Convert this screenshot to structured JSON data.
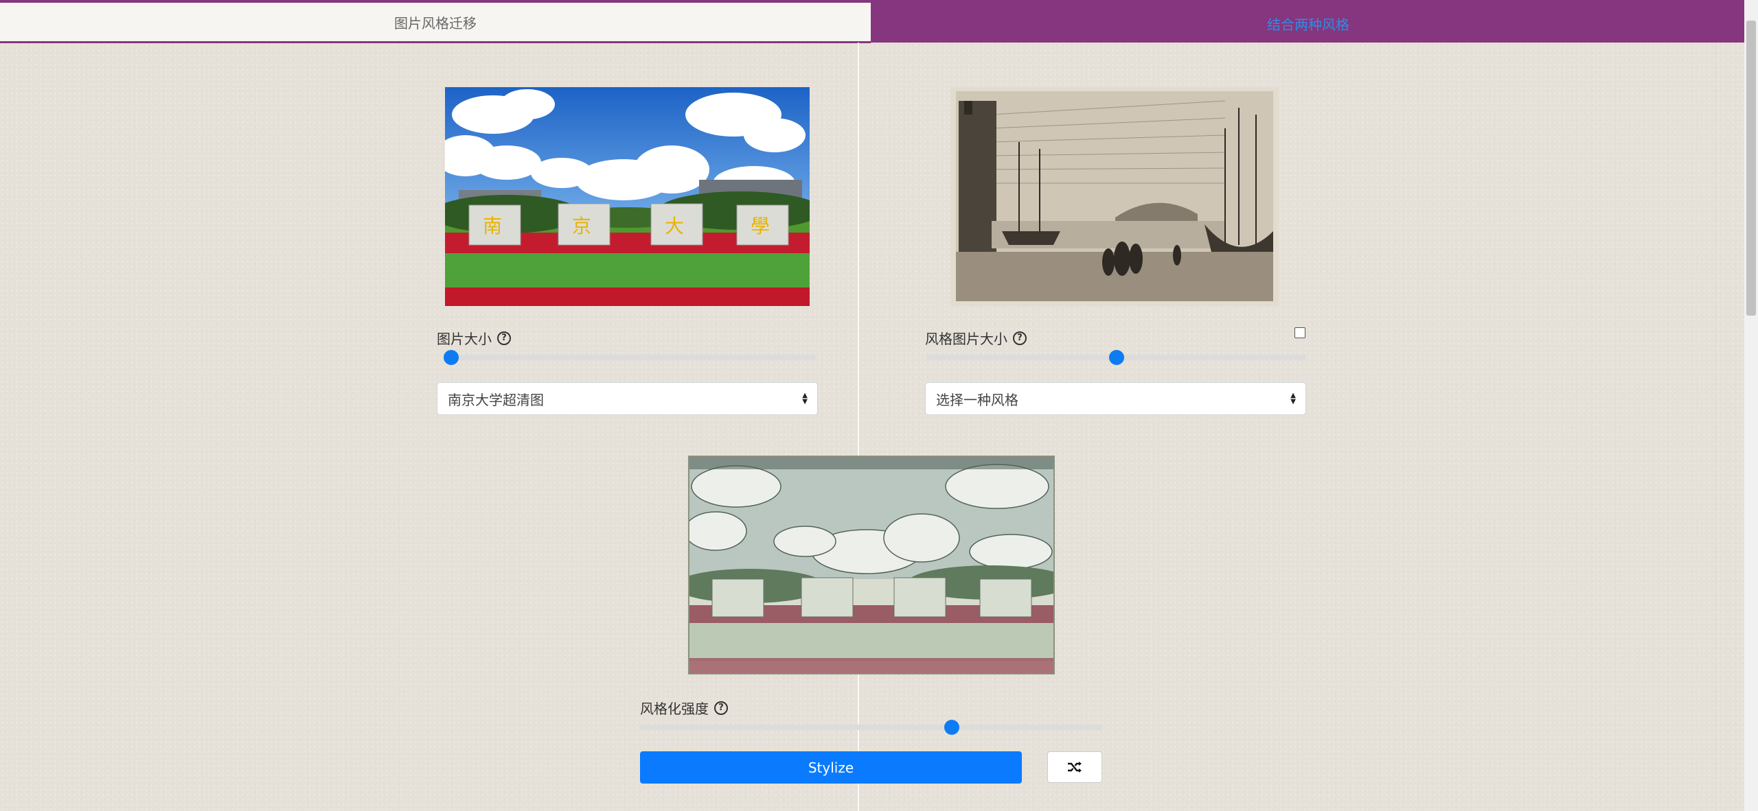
{
  "tabs": [
    {
      "label": "图片风格迁移",
      "active": true
    },
    {
      "label": "结合两种风格",
      "active": false
    }
  ],
  "content": {
    "size_label": "图片大小",
    "size_value": 0.0,
    "image_select": "南京大学超清图"
  },
  "style": {
    "size_label": "风格图片大小",
    "size_value": 0.5,
    "image_select": "选择一种风格"
  },
  "result": {
    "strength_label": "风格化强度",
    "strength_value": 0.68
  },
  "buttons": {
    "stylize": "Stylize"
  },
  "icons": [
    "help-icon",
    "shuffle-icon",
    "dropdown-caret-icon"
  ],
  "colors": {
    "tab_bar": "#86367e",
    "accent": "#0a7bff",
    "tab_link": "#2f8be6"
  }
}
